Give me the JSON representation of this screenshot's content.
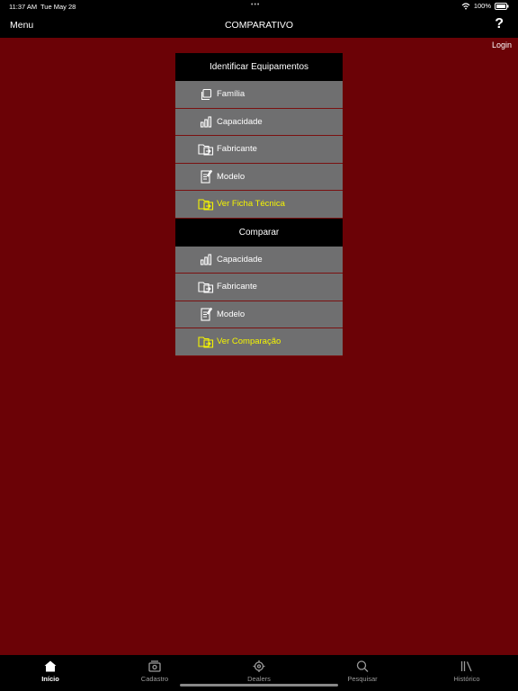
{
  "status": {
    "time": "11:37 AM",
    "date": "Tue May 28",
    "battery": "100%"
  },
  "nav": {
    "menu": "Menu",
    "title": "COMPARATIVO",
    "help": "?",
    "login": "Login"
  },
  "section1": {
    "header": "Identificar Equipamentos",
    "items": [
      {
        "label": "Família",
        "icon": "copy-icon"
      },
      {
        "label": "Capacidade",
        "icon": "bar-chart-icon"
      },
      {
        "label": "Fabricante",
        "icon": "folder-transfer-icon"
      },
      {
        "label": "Modelo",
        "icon": "edit-document-icon"
      },
      {
        "label": "Ver Ficha Técnica",
        "icon": "folder-transfer-icon"
      }
    ]
  },
  "section2": {
    "header": "Comparar",
    "items": [
      {
        "label": "Capacidade",
        "icon": "bar-chart-icon"
      },
      {
        "label": "Fabricante",
        "icon": "folder-transfer-icon"
      },
      {
        "label": "Modelo",
        "icon": "edit-document-icon"
      },
      {
        "label": "Ver Comparação",
        "icon": "folder-transfer-icon"
      }
    ]
  },
  "tabs": [
    {
      "label": "Início",
      "icon": "home-icon"
    },
    {
      "label": "Cadastro",
      "icon": "register-icon"
    },
    {
      "label": "Dealers",
      "icon": "location-icon"
    },
    {
      "label": "Pesquisar",
      "icon": "search-icon"
    },
    {
      "label": "Histórico",
      "icon": "library-icon"
    }
  ],
  "colors": {
    "background": "#6b0206",
    "row": "#6f6f70",
    "accent": "#f5f500"
  }
}
